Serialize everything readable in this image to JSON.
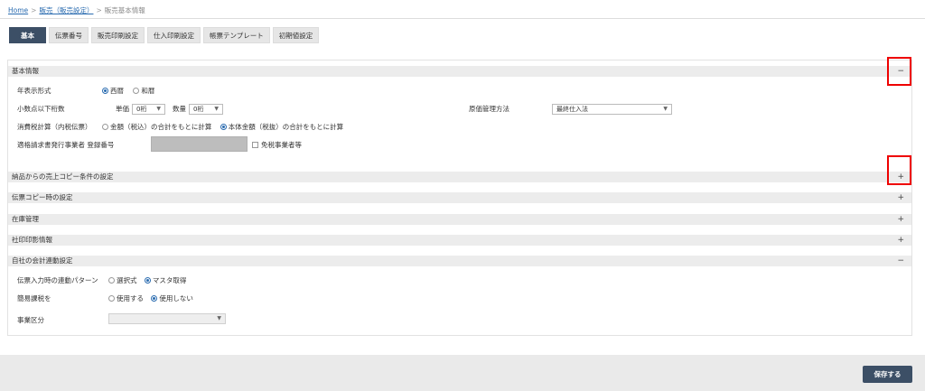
{
  "breadcrumb": {
    "home": "Home",
    "parent": "販売（販売設定）",
    "current": "販売基本情報",
    "sep": ">"
  },
  "tabs": [
    {
      "label": "基本",
      "active": true
    },
    {
      "label": "伝票番号"
    },
    {
      "label": "販売印刷設定"
    },
    {
      "label": "仕入印刷設定"
    },
    {
      "label": "帳票テンプレート"
    },
    {
      "label": "初期値設定"
    }
  ],
  "sections": {
    "basic": {
      "title": "基本情報",
      "toggle": "−",
      "year_format": {
        "label": "年表示形式",
        "opt1": "西暦",
        "opt2": "和暦",
        "selected": "西暦"
      },
      "decimals": {
        "label": "小数点以下桁数",
        "unit_label": "単価",
        "unit_value": "0桁",
        "qty_label": "数量",
        "qty_value": "0桁"
      },
      "cost_method": {
        "label": "原価管理方法",
        "value": "最終仕入法"
      },
      "tax_calc": {
        "label": "消費税計算（内税伝票）",
        "opt1": "金額（税込）の合計をもとに計算",
        "opt2": "本体金額（税抜）の合計をもとに計算",
        "selected": "本体金額（税抜）の合計をもとに計算"
      },
      "invoice": {
        "label": "適格請求書発行事業者 登録番号",
        "exempt": "免税事業者等"
      }
    },
    "copy_conditions": {
      "title": "納品からの売上コピー条件の設定",
      "toggle": "+"
    },
    "slip_copy": {
      "title": "伝票コピー時の設定",
      "toggle": "+"
    },
    "inventory": {
      "title": "在庫管理",
      "toggle": "+"
    },
    "company_seal": {
      "title": "社印印影情報",
      "toggle": "+"
    },
    "accounting": {
      "title": "自社の会計連動設定",
      "toggle": "−",
      "pattern": {
        "label": "伝票入力時の連動パターン",
        "opt1": "選択式",
        "opt2": "マスタ取得",
        "selected": "マスタ取得"
      },
      "simple_tax": {
        "label": "簡易課税を",
        "opt1": "使用する",
        "opt2": "使用しない",
        "selected": "使用しない"
      },
      "business_type": {
        "label": "事業区分",
        "value": ""
      }
    }
  },
  "footer": {
    "save_label": "保存する"
  },
  "colors": {
    "accent": "#3c4f66",
    "link": "#2b6cb0",
    "highlight": "#ee0000"
  },
  "icons": {
    "dropdown": "chevron-down-icon",
    "collapse": "minus-icon",
    "expand": "plus-icon"
  }
}
